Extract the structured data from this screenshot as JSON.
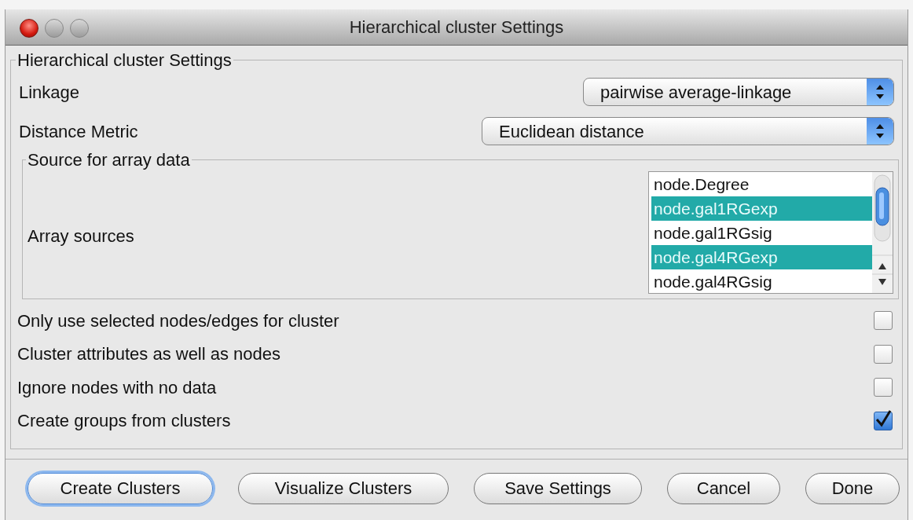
{
  "window": {
    "title": "Hierarchical cluster Settings"
  },
  "group": {
    "legend": "Hierarchical cluster Settings"
  },
  "dropdowns": [
    {
      "label": "Linkage",
      "value": "pairwise average-linkage"
    },
    {
      "label": "Distance Metric",
      "value": "Euclidean distance"
    }
  ],
  "source_group": {
    "legend": "Source for array data",
    "label": "Array sources",
    "items": [
      {
        "text": "node.Degree",
        "selected": false
      },
      {
        "text": "node.gal1RGexp",
        "selected": true
      },
      {
        "text": "node.gal1RGsig",
        "selected": false
      },
      {
        "text": "node.gal4RGexp",
        "selected": true
      },
      {
        "text": "node.gal4RGsig",
        "selected": false
      }
    ]
  },
  "options": [
    {
      "label": "Only use selected nodes/edges for cluster",
      "checked": false
    },
    {
      "label": "Cluster attributes as well as nodes",
      "checked": false
    },
    {
      "label": "Ignore nodes with no data",
      "checked": false
    },
    {
      "label": "Create groups from clusters",
      "checked": true
    }
  ],
  "buttons": [
    {
      "label": "Create Clusters",
      "focused": true
    },
    {
      "label": "Visualize Clusters",
      "focused": false
    },
    {
      "label": "Save Settings",
      "focused": false
    },
    {
      "label": "Cancel",
      "focused": false
    },
    {
      "label": "Done",
      "focused": false
    }
  ]
}
